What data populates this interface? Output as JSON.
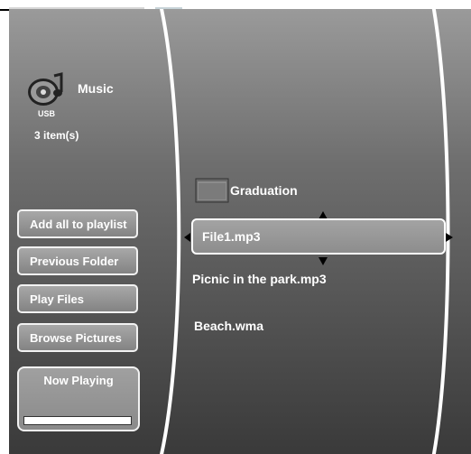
{
  "source": {
    "title": "Music",
    "device": "USB",
    "item_count": "3 item(s)"
  },
  "side_menu": {
    "add_all": "Add all to playlist",
    "previous_folder": "Previous Folder",
    "play_files": "Play Files",
    "browse_pictures": "Browse Pictures"
  },
  "now_playing": {
    "label": "Now Playing",
    "progress": 0
  },
  "file_list": {
    "folder": "Graduation",
    "selected": "File1.mp3",
    "item_2": "Picnic in the park.mp3",
    "item_3": "Beach.wma"
  },
  "icons": {
    "source": "music-speaker-icon",
    "folder": "folder-icon",
    "scroll_up": "arrow-up-icon",
    "scroll_down": "arrow-down-icon",
    "expand": "arrow-right-icon"
  }
}
